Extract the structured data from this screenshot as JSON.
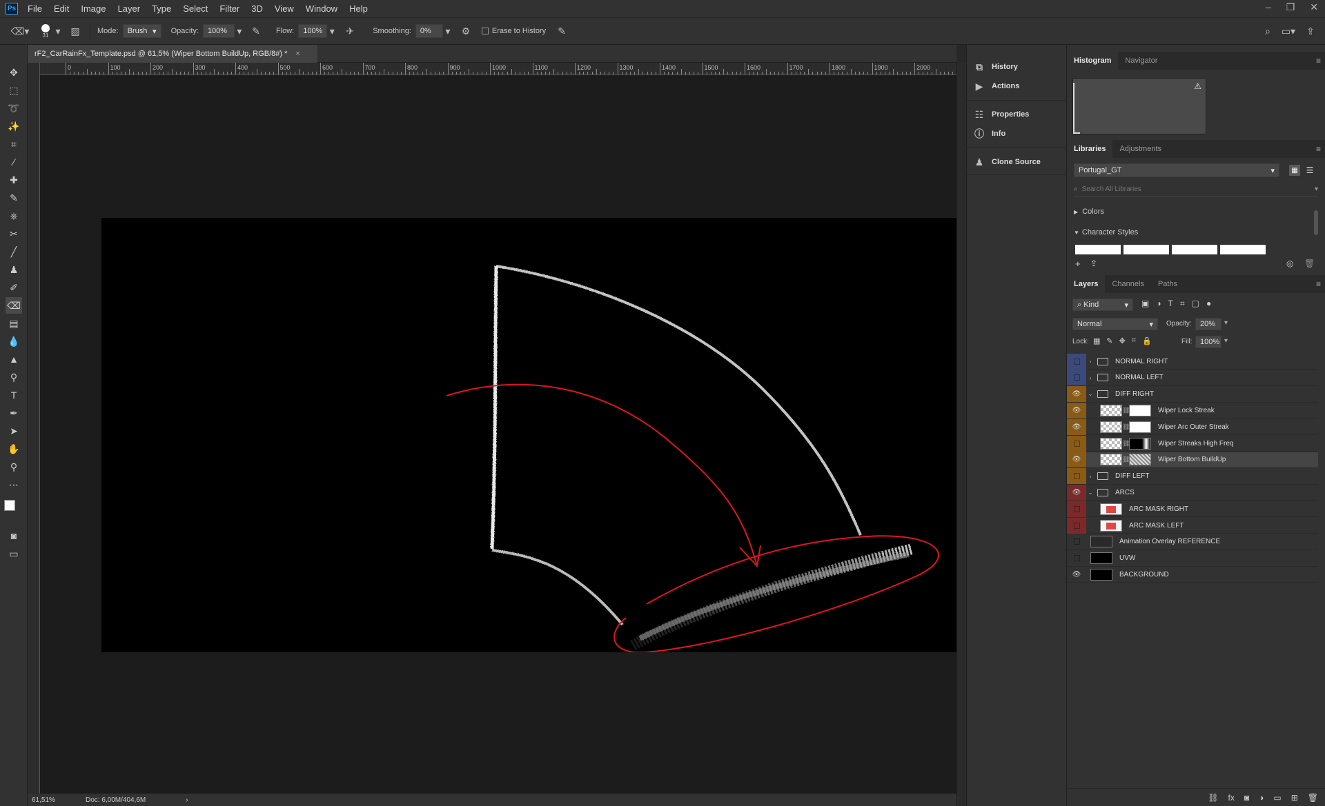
{
  "menubar": {
    "logo": "Ps",
    "items": [
      "File",
      "Edit",
      "Image",
      "Layer",
      "Type",
      "Select",
      "Filter",
      "3D",
      "View",
      "Window",
      "Help"
    ]
  },
  "options": {
    "brush_size": "31",
    "mode_label": "Mode:",
    "mode_value": "Brush",
    "opacity_label": "Opacity:",
    "opacity_value": "100%",
    "flow_label": "Flow:",
    "flow_value": "100%",
    "smoothing_label": "Smoothing:",
    "smoothing_value": "0%",
    "erase_history_label": "Erase to History"
  },
  "document": {
    "tab_title": "rF2_CarRainFx_Template.psd @ 61,5% (Wiper Bottom BuildUp, RGB/8#) *",
    "close": "×",
    "zoom": "61,51%",
    "doc_size": "Doc: 6,00M/404,6M"
  },
  "ruler": {
    "labels": [
      "0",
      "100",
      "200",
      "300",
      "400",
      "500",
      "600",
      "700",
      "800",
      "900",
      "1000",
      "1100",
      "1200",
      "1300",
      "1400",
      "1500",
      "1600",
      "1700",
      "1800",
      "1900",
      "2000"
    ]
  },
  "dock": {
    "items": [
      "History",
      "Actions",
      "Properties",
      "Info",
      "Clone Source"
    ]
  },
  "histogram_panel": {
    "tabs": [
      "Histogram",
      "Navigator"
    ]
  },
  "libraries_panel": {
    "tabs": [
      "Libraries",
      "Adjustments"
    ],
    "library_name": "Portugal_GT",
    "search_placeholder": "Search All Libraries",
    "sections": [
      "Colors",
      "Character Styles"
    ]
  },
  "layers_panel": {
    "tabs": [
      "Layers",
      "Channels",
      "Paths"
    ],
    "filter_kind": "Kind",
    "blend_mode": "Normal",
    "opacity_label": "Opacity:",
    "opacity_value": "20%",
    "lock_label": "Lock:",
    "fill_label": "Fill:",
    "fill_value": "100%",
    "layers": [
      {
        "name": "NORMAL RIGHT",
        "type": "group",
        "visible": false,
        "color": "#3b4a7a",
        "indent": 0,
        "expanded": false
      },
      {
        "name": "NORMAL LEFT",
        "type": "group",
        "visible": false,
        "color": "#3b4a7a",
        "indent": 0,
        "expanded": false
      },
      {
        "name": "DIFF RIGHT",
        "type": "group",
        "visible": true,
        "color": "#8a5a17",
        "indent": 0,
        "expanded": true
      },
      {
        "name": "Wiper Lock Streak",
        "type": "layer",
        "visible": true,
        "color": "#8a5a17",
        "indent": 1,
        "mask": "white"
      },
      {
        "name": "Wiper Arc Outer Streak",
        "type": "layer",
        "visible": true,
        "color": "#8a5a17",
        "indent": 1,
        "mask": "white"
      },
      {
        "name": "Wiper Streaks High Freq",
        "type": "layer",
        "visible": false,
        "color": "#8a5a17",
        "indent": 1,
        "mask": "black"
      },
      {
        "name": "Wiper Bottom BuildUp",
        "type": "layer",
        "visible": true,
        "color": "#8a5a17",
        "indent": 1,
        "mask": "texture",
        "selected": true
      },
      {
        "name": "DIFF LEFT",
        "type": "group",
        "visible": false,
        "color": "#8a5a17",
        "indent": 0,
        "expanded": false
      },
      {
        "name": "ARCS",
        "type": "group",
        "visible": true,
        "color": "#7a2a2a",
        "indent": 0,
        "expanded": true
      },
      {
        "name": "ARC MASK RIGHT",
        "type": "layer",
        "visible": false,
        "color": "#7a2a2a",
        "indent": 1
      },
      {
        "name": "ARC MASK LEFT",
        "type": "layer",
        "visible": false,
        "color": "#7a2a2a",
        "indent": 1
      },
      {
        "name": "Animation Overlay REFERENCE",
        "type": "layer",
        "visible": false,
        "color": "",
        "indent": 0
      },
      {
        "name": "UVW",
        "type": "layer",
        "visible": false,
        "color": "",
        "indent": 0
      },
      {
        "name": "BACKGROUND",
        "type": "layer",
        "visible": true,
        "color": "",
        "indent": 0
      }
    ]
  },
  "colors": {
    "annotation_red": "#e0141e",
    "accent_blue": "#3b4a7a",
    "accent_orange": "#8a5a17",
    "accent_red": "#7a2a2a"
  }
}
